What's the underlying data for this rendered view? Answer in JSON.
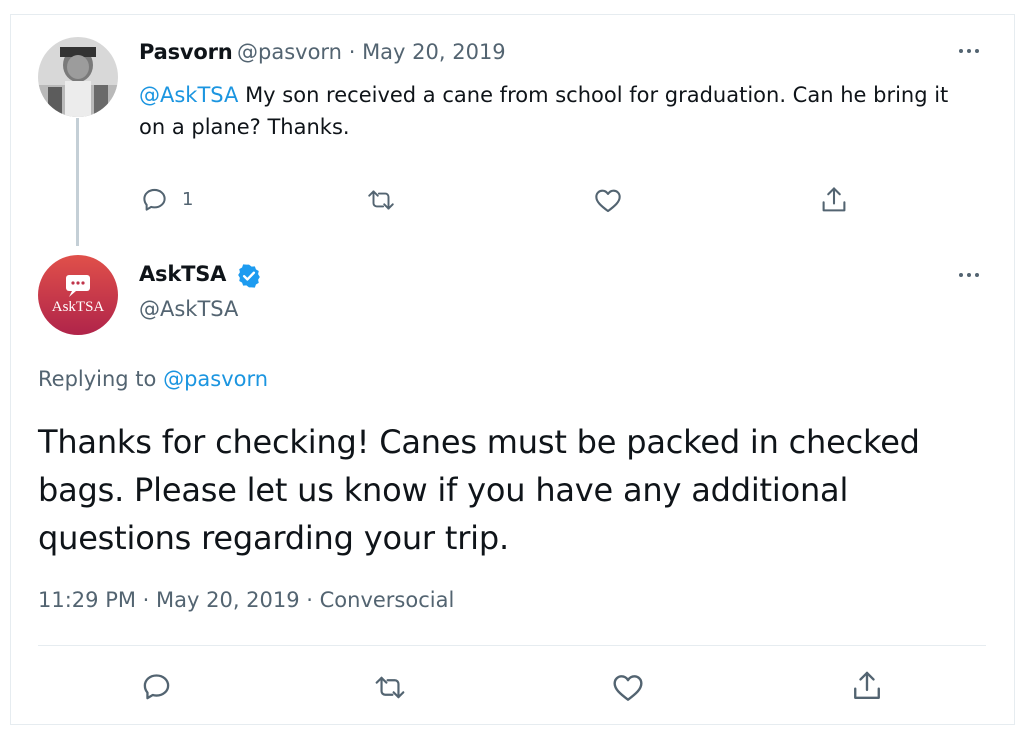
{
  "parent_tweet": {
    "display_name": "Pasvorn",
    "handle": "@pasvorn",
    "separator": "·",
    "date": "May 20, 2019",
    "mention": "@AskTSA",
    "text": " My son received a cane from school for graduation. Can he bring it on a plane? Thanks.",
    "reply_count": "1"
  },
  "main_tweet": {
    "display_name": "AskTSA",
    "handle": "@AskTSA",
    "avatar_label": "AskTSA",
    "replying_prefix": "Replying to ",
    "replying_to": "@pasvorn",
    "text": "Thanks for checking! Canes must be packed in checked bags. Please let us know if you have any additional questions regarding your trip.",
    "meta": "11:29 PM · May 20, 2019 · Conversocial"
  },
  "colors": {
    "link": "#1b95e0",
    "verified": "#1d9bf0",
    "asktsa_gradient_top": "#e0504a",
    "asktsa_gradient_bottom": "#b0244a"
  },
  "icons": [
    "more-icon",
    "reply-icon",
    "retweet-icon",
    "like-icon",
    "share-icon",
    "verified-badge-icon"
  ]
}
